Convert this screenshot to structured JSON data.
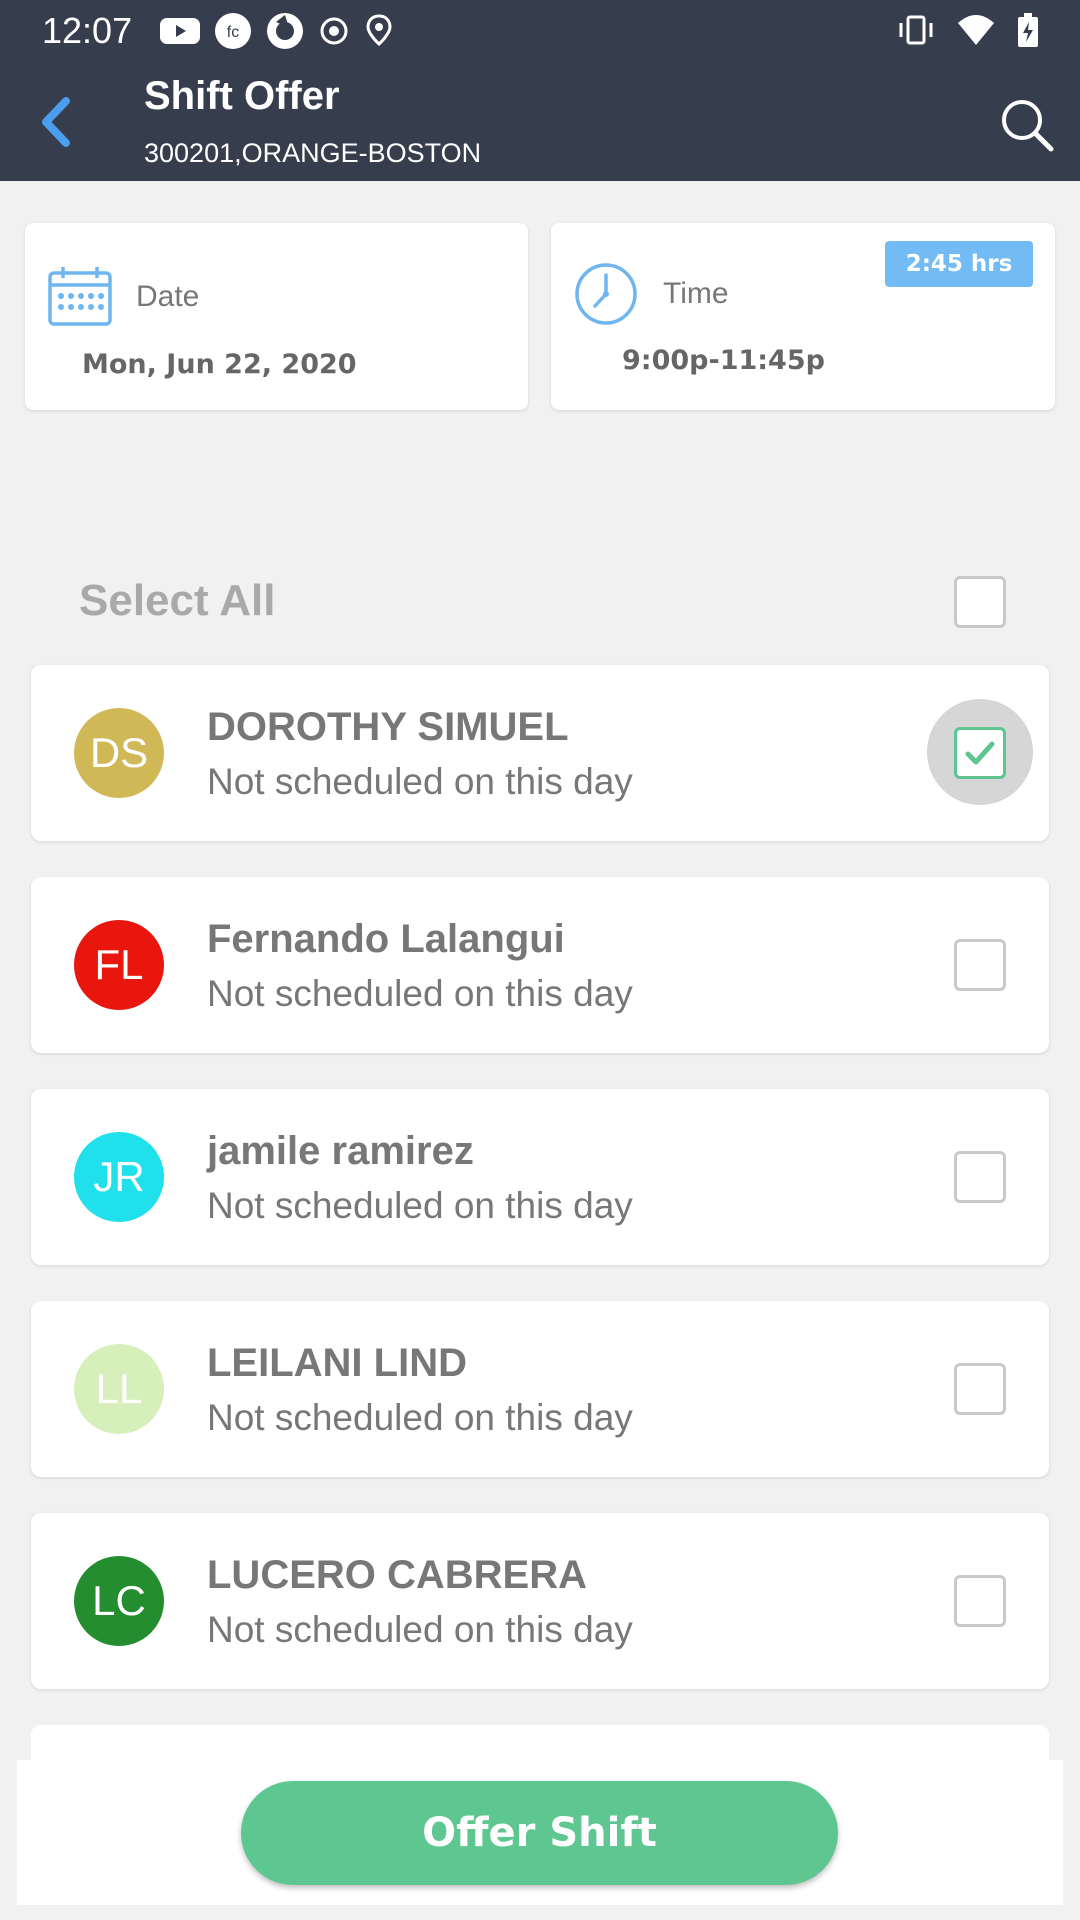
{
  "status_bar": {
    "time": "12:07"
  },
  "header": {
    "title": "Shift Offer",
    "subtitle": "300201,ORANGE-BOSTON"
  },
  "date_card": {
    "label": "Date",
    "value": "Mon, Jun 22, 2020"
  },
  "time_card": {
    "label": "Time",
    "value": "9:00p-11:45p",
    "duration": "2:45 hrs"
  },
  "select_all": {
    "label": "Select All",
    "checked": false
  },
  "employees": [
    {
      "initials": "DS",
      "name": "DOROTHY SIMUEL",
      "status": "Not scheduled on this day",
      "color": "#d1b857",
      "checked": true
    },
    {
      "initials": "FL",
      "name": "Fernando Lalangui",
      "status": "Not scheduled on this day",
      "color": "#e8160c",
      "checked": false
    },
    {
      "initials": "JR",
      "name": "jamile ramirez",
      "status": "Not scheduled on this day",
      "color": "#20e0eb",
      "checked": false
    },
    {
      "initials": "LL",
      "name": "LEILANI LIND",
      "status": "Not scheduled on this day",
      "color": "#d7efbb",
      "checked": false
    },
    {
      "initials": "LC",
      "name": "LUCERO CABRERA",
      "status": "Not scheduled on this day",
      "color": "#238d2f",
      "checked": false
    }
  ],
  "footer": {
    "offer_label": "Offer Shift"
  },
  "colors": {
    "header_bg": "#363d4d",
    "accent_blue": "#73bbf4",
    "accent_green": "#5ec690"
  }
}
